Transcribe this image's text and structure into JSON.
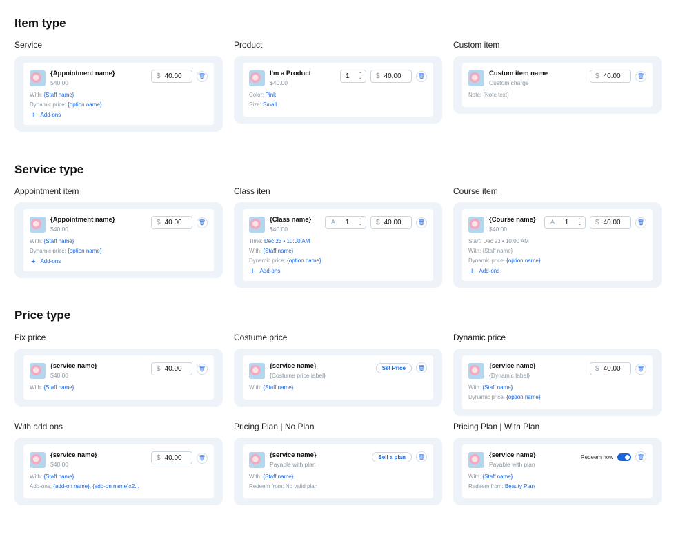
{
  "sections": {
    "item_type": "Item type",
    "service_type": "Service type",
    "price_type": "Price type"
  },
  "labels": {
    "service": "Service",
    "product": "Product",
    "custom_item": "Custom item",
    "appointment_item": "Appointment item",
    "class_item": "Class iten",
    "course_item": "Course item",
    "fix_price": "Fix price",
    "costume_price": "Costume price",
    "dynamic_price": "Dynamic price",
    "with_add_ons": "With add ons",
    "pricing_no_plan": "Pricing Plan | No Plan",
    "pricing_with_plan": "Pricing Plan | With Plan"
  },
  "common": {
    "currency": "$",
    "price": "40.00",
    "qty": "1",
    "add_ons": "Add-ons",
    "with": "With:",
    "dynamic_price": "Dynamic price:",
    "staff_name_var": "{Staff name}",
    "staff_name_plain": "{Staff name}",
    "option_name_var": "{option name}",
    "icons": {
      "trash": "trash-icon",
      "plus": "plus-icon",
      "stepper": "chevron-up-down-icon",
      "staff": "staff-icon",
      "thumb": "product-thumbnail"
    }
  },
  "cards": {
    "service": {
      "name": "{Appointment name}",
      "sub": "$40.00"
    },
    "product": {
      "name": "I'm a Product",
      "sub": "$40.00",
      "color_label": "Color:",
      "color_value": "Pink",
      "size_label": "Size:",
      "size_value": "Small"
    },
    "custom": {
      "name": "Custom item name",
      "sub": "Custom charge",
      "note": "Note: {Note text}"
    },
    "appointment": {
      "name": "{Appointment name}",
      "sub": "$40.00"
    },
    "class": {
      "name": "{Class name}",
      "sub": "$40.00",
      "time_label": "Time:",
      "time_value": "Dec 23 • 10:00 AM"
    },
    "course": {
      "name": "{Course name}",
      "sub": "$40.00",
      "start_label": "Start:",
      "start_value": "Dec 23 • 10:00 AM",
      "with_text": "With: {Staff name}"
    },
    "fix": {
      "name": "{service name}",
      "sub": "$40.00"
    },
    "costume": {
      "name": "{service name}",
      "sub": "{Costume price label}",
      "button": "Set Price"
    },
    "dynamic": {
      "name": "{service name}",
      "sub": "{Dynamic label}"
    },
    "addons": {
      "name": "{service name}",
      "sub": "$40.00",
      "addons_label": "Add-ons:",
      "addons_value": "{add-on name}, {add-on name}x2..."
    },
    "no_plan": {
      "name": "{service name}",
      "sub": "Payable with plan",
      "button": "Sell a plan",
      "redeem_text": "Redeem from: No valid plan"
    },
    "with_plan": {
      "name": "{service name}",
      "sub": "Payable with plan",
      "redeem_now": "Redeem now",
      "redeem_label": "Redeem from:",
      "redeem_value": "Beauty Plan"
    }
  }
}
